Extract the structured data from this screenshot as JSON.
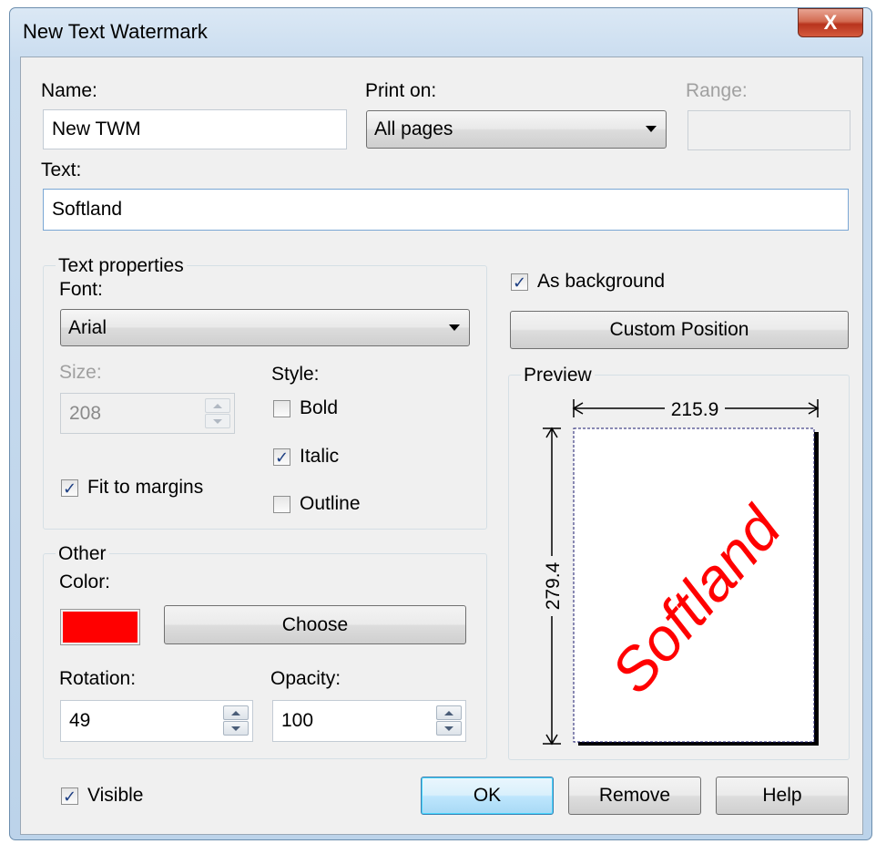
{
  "window": {
    "title": "New Text Watermark",
    "close_glyph": "X"
  },
  "name": {
    "label": "Name:",
    "value": "New TWM"
  },
  "print_on": {
    "label": "Print on:",
    "value": "All pages"
  },
  "range": {
    "label": "Range:",
    "value": ""
  },
  "text": {
    "label": "Text:",
    "value": "Softland"
  },
  "text_properties": {
    "group_title": "Text properties",
    "font_label": "Font:",
    "font_value": "Arial",
    "size_label": "Size:",
    "size_value": "208",
    "style_label": "Style:",
    "bold_label": "Bold",
    "bold_checked": false,
    "italic_label": "Italic",
    "italic_checked": true,
    "outline_label": "Outline",
    "outline_checked": false,
    "fit_label": "Fit to margins",
    "fit_checked": true
  },
  "other": {
    "group_title": "Other",
    "color_label": "Color:",
    "color_value": "#ff0000",
    "choose_label": "Choose",
    "rotation_label": "Rotation:",
    "rotation_value": "49",
    "opacity_label": "Opacity:",
    "opacity_value": "100"
  },
  "as_background": {
    "label": "As background",
    "checked": true
  },
  "custom_position_label": "Custom Position",
  "preview": {
    "group_title": "Preview",
    "width_label": "215.9",
    "height_label": "279.4",
    "watermark_text": "Softland",
    "watermark_color": "#ff0000",
    "rotation_deg": 49
  },
  "visible": {
    "label": "Visible",
    "checked": true
  },
  "buttons": {
    "ok": "OK",
    "remove": "Remove",
    "help": "Help"
  },
  "colors": {
    "accent": "#3c7fb1",
    "dialog_bg": "#f0f0f0",
    "watermark": "#ff0000"
  }
}
